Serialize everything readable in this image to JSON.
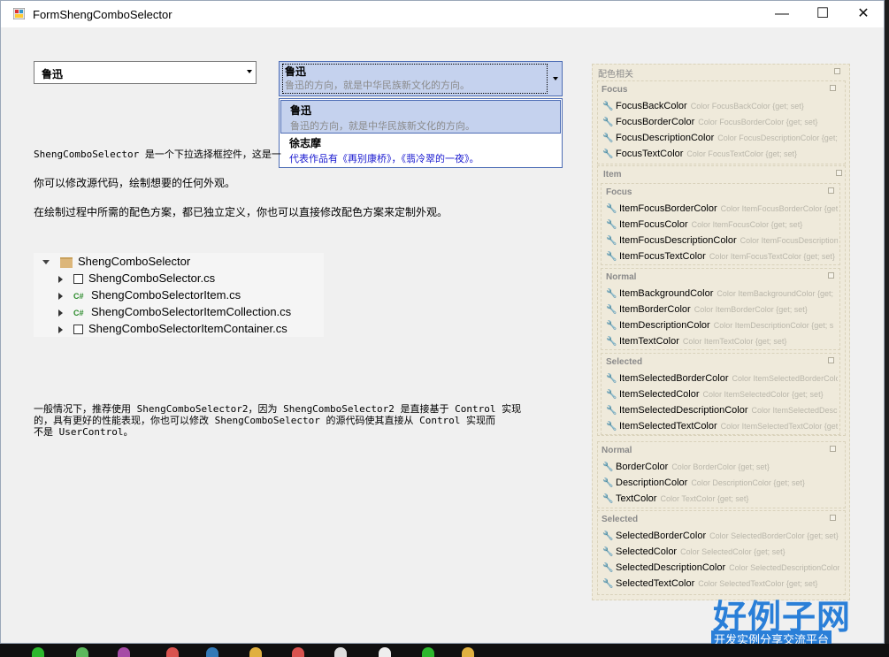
{
  "window": {
    "title": "FormShengComboSelector"
  },
  "combo1": {
    "value": "鲁迅"
  },
  "combo2": {
    "title": "鲁迅",
    "description": "鲁迅的方向，就是中华民族新文化的方向。"
  },
  "dropdown": {
    "items": [
      {
        "title": "鲁迅",
        "description": "鲁迅的方向，就是中华民族新文化的方向。"
      },
      {
        "title": "徐志摩",
        "description": "代表作品有《再别康桥》，《翡冷翠的一夜》。"
      }
    ]
  },
  "text": {
    "line1": "ShengComboSelector 是一个下拉选择框控件，这是一",
    "line2": "你可以修改源代码，绘制想要的任何外观。",
    "line3": "在绘制过程中所需的配色方案，都已独立定义，你也可以直接修改配色方案来定制外观。",
    "lower1": "一般情况下，推荐使用 ShengComboSelector2，因为 ShengComboSelector2 是直接基于 Control 实现",
    "lower2": "的，具有更好的性能表现，你也可以修改 ShengComboSelector 的源代码使其直接从 Control 实现而",
    "lower3": "不是 UserControl。"
  },
  "tree": {
    "root": "ShengComboSelector",
    "children": [
      {
        "name": "ShengComboSelector.cs",
        "icon": "component-icon"
      },
      {
        "name": "ShengComboSelectorItem.cs",
        "icon": "csharp-icon"
      },
      {
        "name": "ShengComboSelectorItemCollection.cs",
        "icon": "csharp-icon"
      },
      {
        "name": "ShengComboSelectorItemContainer.cs",
        "icon": "component-icon"
      }
    ]
  },
  "props": {
    "title": "配色相关",
    "focus": {
      "title": "Focus",
      "items": [
        {
          "name": "FocusBackColor",
          "desc": "Color FocusBackColor {get; set}"
        },
        {
          "name": "FocusBorderColor",
          "desc": "Color FocusBorderColor {get; set}"
        },
        {
          "name": "FocusDescriptionColor",
          "desc": "Color FocusDescriptionColor {get;"
        },
        {
          "name": "FocusTextColor",
          "desc": "Color FocusTextColor {get; set}"
        }
      ]
    },
    "item": {
      "title": "Item",
      "focus": {
        "title": "Focus",
        "items": [
          {
            "name": "ItemFocusBorderColor",
            "desc": "Color ItemFocusBorderColor {get"
          },
          {
            "name": "ItemFocusColor",
            "desc": "Color ItemFocusColor {get; set}"
          },
          {
            "name": "ItemFocusDescriptionColor",
            "desc": "Color ItemFocusDescription"
          },
          {
            "name": "ItemFocusTextColor",
            "desc": "Color ItemFocusTextColor {get; set}"
          }
        ]
      },
      "normal": {
        "title": "Normal",
        "items": [
          {
            "name": "ItemBackgroundColor",
            "desc": "Color ItemBackgroundColor {get;"
          },
          {
            "name": "ItemBorderColor",
            "desc": "Color ItemBorderColor {get; set}"
          },
          {
            "name": "ItemDescriptionColor",
            "desc": "Color ItemDescriptionColor {get; s"
          },
          {
            "name": "ItemTextColor",
            "desc": "Color ItemTextColor {get; set}"
          }
        ]
      },
      "selected": {
        "title": "Selected",
        "items": [
          {
            "name": "ItemSelectedBorderColor",
            "desc": "Color ItemSelectedBorderColo"
          },
          {
            "name": "ItemSelectedColor",
            "desc": "Color ItemSelectedColor {get; set}"
          },
          {
            "name": "ItemSelectedDescriptionColor",
            "desc": "Color ItemSelectedDescri"
          },
          {
            "name": "ItemSelectedTextColor",
            "desc": "Color ItemSelectedTextColor {get;"
          }
        ]
      }
    },
    "normal": {
      "title": "Normal",
      "items": [
        {
          "name": "BorderColor",
          "desc": "Color BorderColor {get; set}"
        },
        {
          "name": "DescriptionColor",
          "desc": "Color DescriptionColor {get; set}"
        },
        {
          "name": "TextColor",
          "desc": "Color TextColor {get; set}"
        }
      ]
    },
    "selected": {
      "title": "Selected",
      "items": [
        {
          "name": "SelectedBorderColor",
          "desc": "Color SelectedBorderColor {get; set}"
        },
        {
          "name": "SelectedColor",
          "desc": "Color SelectedColor {get; set}"
        },
        {
          "name": "SelectedDescriptionColor",
          "desc": "Color SelectedDescriptionColor"
        },
        {
          "name": "SelectedTextColor",
          "desc": "Color SelectedTextColor {get; set}"
        }
      ]
    }
  },
  "watermark": {
    "brand": "好例子网",
    "tagline": "开发实例分享交流平台"
  },
  "colors": {
    "accent": "#4d6db5",
    "selection": "#c5d2ee",
    "link": "#1a1ad0"
  }
}
